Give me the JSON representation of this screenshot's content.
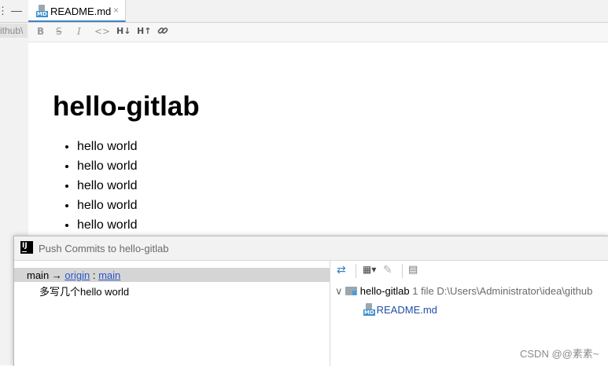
{
  "left_panel": {
    "tool_a": "⋮",
    "tool_b": "—",
    "path_fragment": "ithub\\"
  },
  "tab": {
    "label": "README.md",
    "close": "×",
    "icon": "markdown-file-icon",
    "icon_label": "MD"
  },
  "md_toolbar": {
    "bold": "B",
    "strike": "S",
    "italic": "I",
    "code": "<>",
    "header_down": "H↓",
    "header_up": "H↑",
    "link": "link-icon"
  },
  "markdown": {
    "heading": "hello-gitlab",
    "items": [
      "hello world",
      "hello world",
      "hello world",
      "hello world",
      "hello world"
    ]
  },
  "dialog": {
    "title": "Push Commits to hello-gitlab",
    "branch": {
      "local": "main",
      "arrow": " → ",
      "remote": "origin",
      "sep": " : ",
      "remote_branch": "main"
    },
    "commit_message": "多写几个hello world",
    "tree": {
      "root_name": "hello-gitlab",
      "root_count": "1 file",
      "root_path": "D:\\Users\\Administrator\\idea\\github",
      "file_name": "README.md"
    },
    "toolbar_icons": [
      "expand-icon",
      "group-by-icon",
      "edit-icon",
      "preview-icon"
    ],
    "more": "⋮"
  },
  "watermark": "CSDN @@素素~",
  "colors": {
    "accent": "#4083c9",
    "link": "#2a56c6",
    "file_blue": "#1f4fa8",
    "selection": "#d5d5d5"
  }
}
